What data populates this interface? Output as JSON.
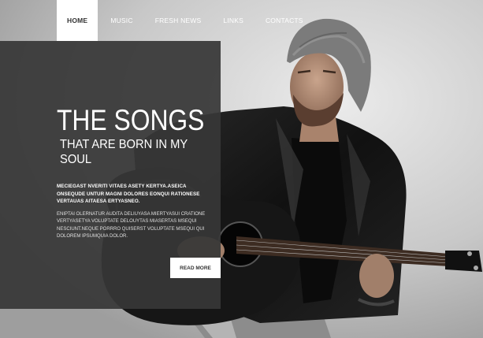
{
  "nav": {
    "items": [
      {
        "label": "HOME",
        "active": true
      },
      {
        "label": "MUSIC",
        "active": false
      },
      {
        "label": "FRESH NEWS",
        "active": false
      },
      {
        "label": "LINKS",
        "active": false
      },
      {
        "label": "CONTACTS",
        "active": false
      }
    ]
  },
  "hero": {
    "title": "THE SONGS",
    "subtitle": "THAT ARE BORN IN MY SOUL",
    "lead": "MECIEGAST NVERITI VITAES ASETY KERTYA.ASEICA ONSEQUDE UNTUR MAGNI DOLORES EONQUI RATIONESE VERTAUAS AITAESA ERTYASNEO.",
    "body": "ENIPTAI OLERNATUR AUDITA DELIUYASA MIERTYASUI CRATIONE VERTYASETYA VOLUPTATE DELOUYTAS MIASERTAS MSEQUI NESCIUNT.NEQUE PORRRO QUISERST VOLUPTATE MSEQUI QUI DOLOREM IPSUMQUIA DOLOR.",
    "button_label": "READ MORE"
  },
  "colors": {
    "panel": "#373737",
    "nav_active_bg": "#ffffff",
    "background": "#cfcfcf"
  },
  "icons": {
    "hero_image": "musician-with-guitar-photo"
  }
}
